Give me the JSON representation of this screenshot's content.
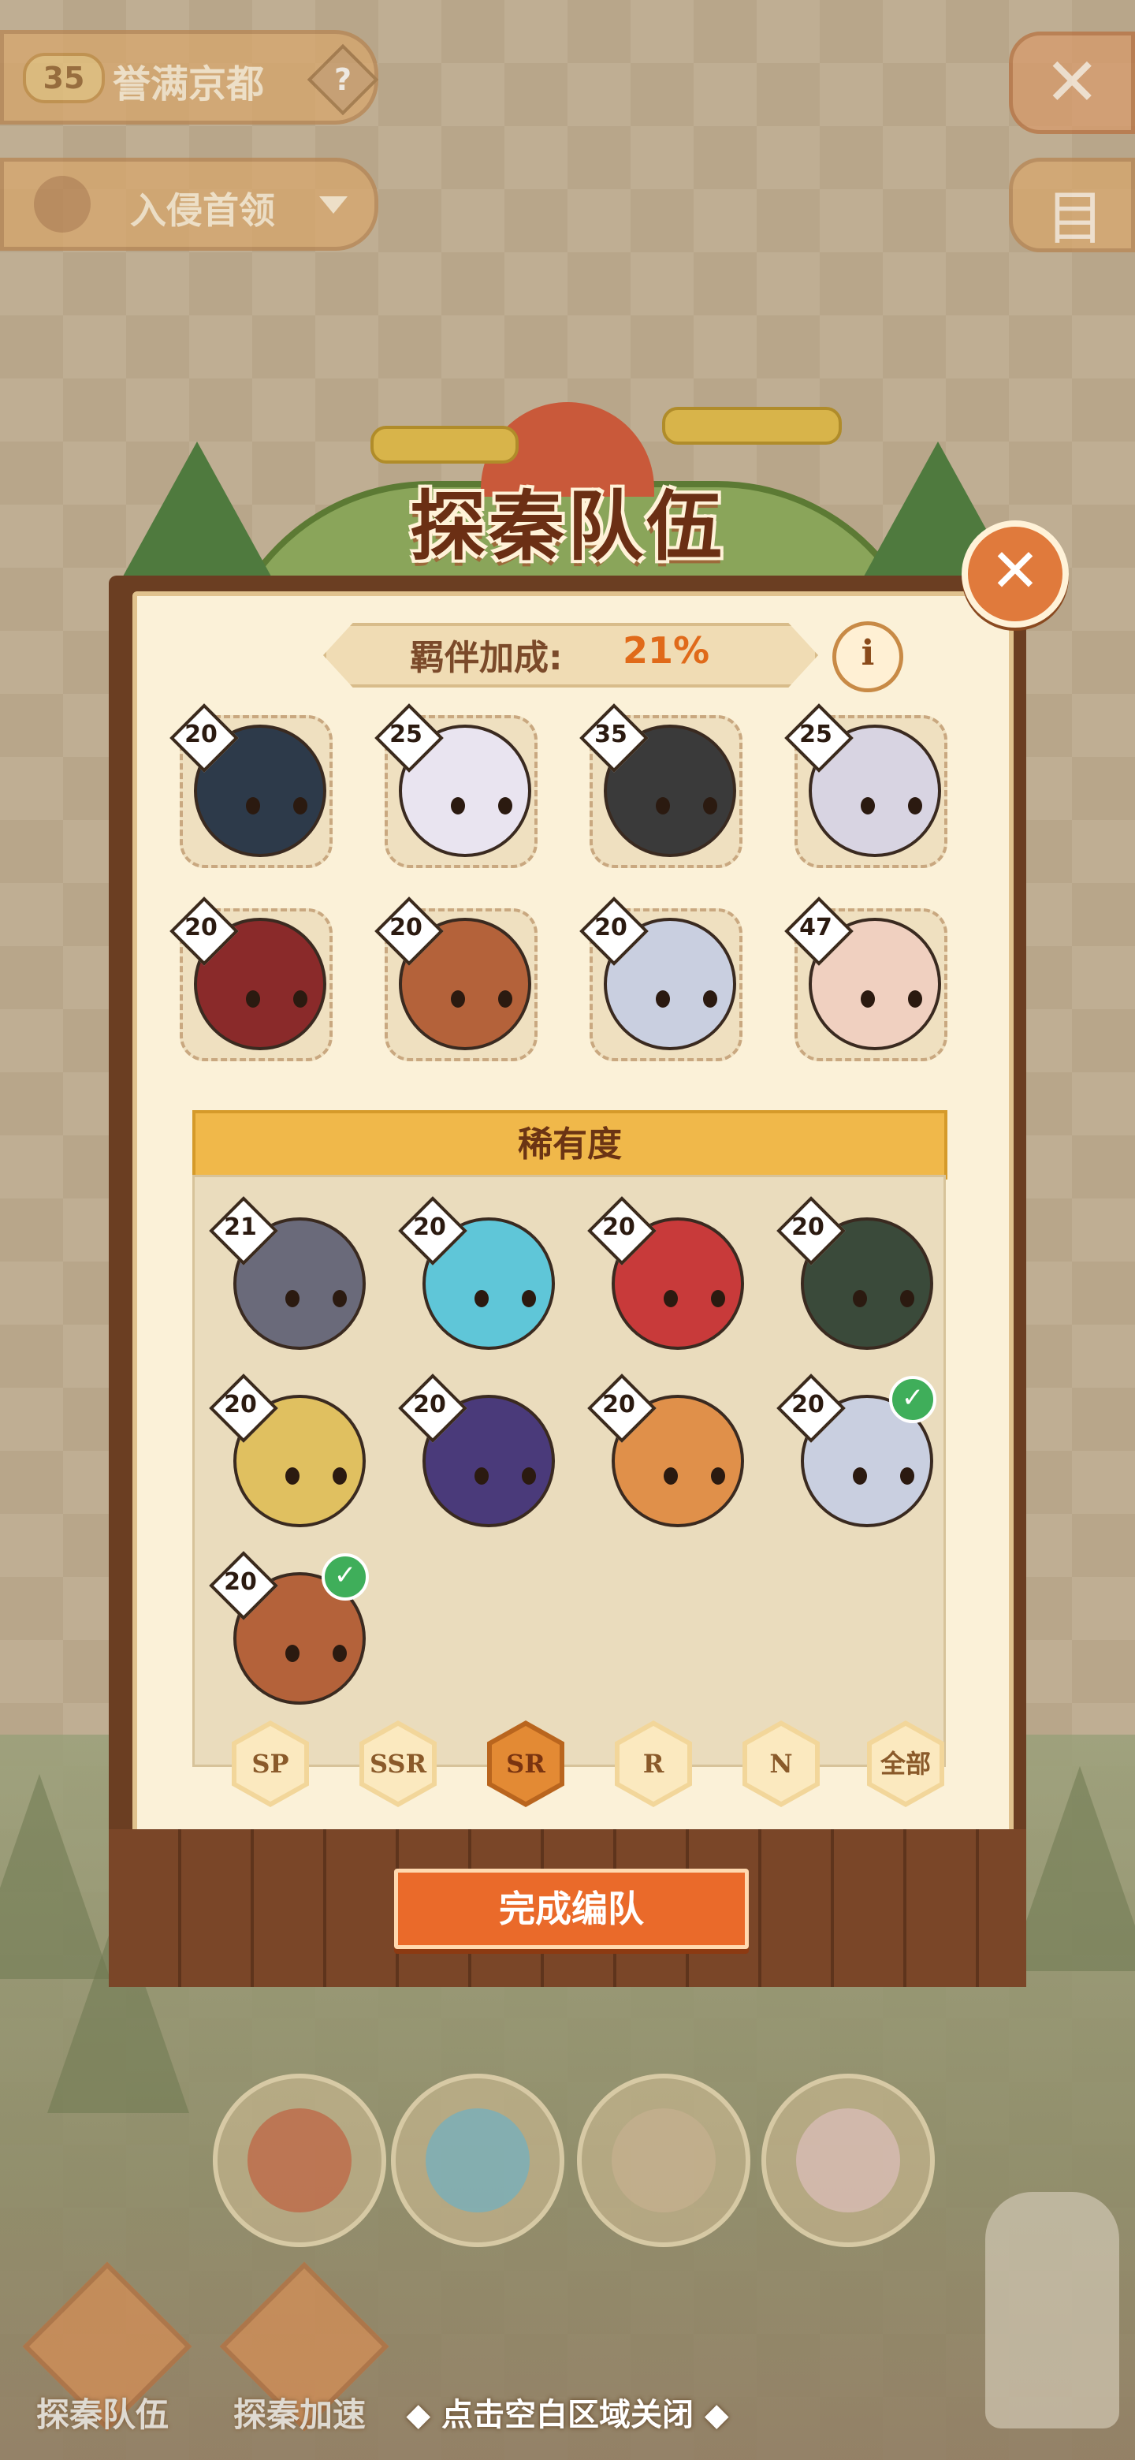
{
  "hud": {
    "level": "35",
    "area_name": "誉满京都",
    "help": "?",
    "boss_filter": "入侵首领",
    "close_symbol": "✕",
    "log_symbol": "目"
  },
  "panel": {
    "title": "探秦队伍",
    "close_symbol": "✕",
    "bond_label": "羁伴加成:",
    "bond_value": "21%",
    "info_symbol": "i",
    "team_members": [
      {
        "level": "20",
        "color": "#2d3a4a"
      },
      {
        "level": "25",
        "color": "#e9e4f0"
      },
      {
        "level": "35",
        "color": "#3a3a3a"
      },
      {
        "level": "25",
        "color": "#d8d4e2"
      },
      {
        "level": "20",
        "color": "#8a2a2a"
      },
      {
        "level": "20",
        "color": "#b4623a"
      },
      {
        "level": "20",
        "color": "#c9cfe0"
      },
      {
        "level": "47",
        "color": "#f0d0c0"
      }
    ],
    "rarity_title": "稀有度",
    "rarity_pool": [
      {
        "level": "21",
        "color": "#6a6a7a",
        "selected": false
      },
      {
        "level": "20",
        "color": "#5fc6d8",
        "selected": false
      },
      {
        "level": "20",
        "color": "#c83a3a",
        "selected": false
      },
      {
        "level": "20",
        "color": "#3a4a3a",
        "selected": false
      },
      {
        "level": "20",
        "color": "#e0c060",
        "selected": false
      },
      {
        "level": "20",
        "color": "#4a3a7a",
        "selected": false
      },
      {
        "level": "20",
        "color": "#e0904a",
        "selected": false
      },
      {
        "level": "20",
        "color": "#c9cfe0",
        "selected": true
      },
      {
        "level": "20",
        "color": "#b4623a",
        "selected": true
      }
    ],
    "rarity_filters": [
      {
        "label": "SP",
        "active": false
      },
      {
        "label": "SSR",
        "active": false
      },
      {
        "label": "SR",
        "active": true
      },
      {
        "label": "R",
        "active": false
      },
      {
        "label": "N",
        "active": false
      },
      {
        "label": "全部",
        "active": false
      }
    ],
    "confirm_label": "完成编队"
  },
  "bottom": {
    "team_button": "探秦队伍",
    "speed_button": "探秦加速",
    "close_hint": "◆ 点击空白区域关闭 ◆"
  }
}
